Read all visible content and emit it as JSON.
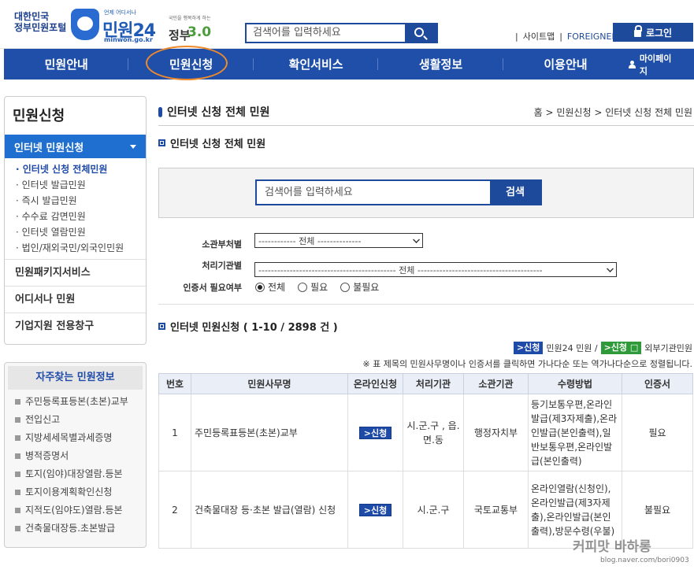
{
  "header": {
    "gov_portal_line1": "대한민국",
    "gov_portal_line2": "정부민원포털",
    "logo_tagline": "언제 어디서나",
    "logo_name": "민원24",
    "logo_url": "minwon.go.kr",
    "gov3_small": "국민을 행복하게 하는",
    "gov3_main": "정부",
    "gov3_num": "3.0",
    "search_placeholder": "검색어를 입력하세요",
    "links": {
      "sitemap": "사이트맵",
      "foreigner": "FOREIGNER"
    },
    "login": "로그인"
  },
  "gnb": {
    "items": [
      "민원안내",
      "민원신청",
      "확인서비스",
      "생활정보",
      "이용안내"
    ],
    "mypage": "마이페이지",
    "highlight_color": "#f08a2b"
  },
  "sidebar": {
    "title": "민원신청",
    "active": "인터넷 민원신청",
    "subitems": [
      "인터넷 신청 전체민원",
      "인터넷 발급민원",
      "즉시 발급민원",
      "수수료 감면민원",
      "인터넷 열람민원",
      "법인/재외국민/외국인민원"
    ],
    "sections": [
      "민원패키지서비스",
      "어디서나 민원",
      "기업지원 전용창구"
    ]
  },
  "frequent": {
    "title": "자주찾는 민원정보",
    "items": [
      "주민등록표등본(초본)교부",
      "전입신고",
      "지방세세목별과세증명",
      "병적증명서",
      "토지(임야)대장열람.등본",
      "토지이용계획확인신청",
      "지적도(임야도)열람.등본",
      "건축물대장등.초본발급"
    ]
  },
  "main": {
    "page_title": "인터넷 신청 전체 민원",
    "breadcrumb": [
      "홈",
      "민원신청",
      "인터넷 신청 전체 민원"
    ],
    "section_title": "인터넷 신청 전체 민원",
    "search_placeholder": "검색어를 입력하세요",
    "search_button": "검색",
    "filters": {
      "dept_label": "소관부처별",
      "dept_value": "------------ 전체 --------------",
      "agency_label": "처리기관별",
      "agency_value": "-------------------------------------------- 전체 ----------------------------------------",
      "cert_label": "인증서 필요여부",
      "cert_options": [
        "전체",
        "필요",
        "불필요"
      ]
    },
    "list_title": "인터넷 민원신청 ( 1-10 / 2898 건 )",
    "legend": {
      "apply_badge": "신청",
      "inner_label": "민원24 민원 /",
      "outer_badge": "신청",
      "outer_label": "외부기관민원"
    },
    "note": "※ 표 제목의 민원사무명이나 인증서를 클릭하면 가나다순 또는 역가나다순으로 정렬됩니다.",
    "table": {
      "headers": [
        "번호",
        "민원사무명",
        "온라인신청",
        "처리기관",
        "소관기관",
        "수령방법",
        "인증서"
      ],
      "rows": [
        {
          "no": "1",
          "name": "주민등록표등본(초본)교부",
          "apply": "신청",
          "proc": "시.군.구 , 읍.면.동",
          "dept": "행정자치부",
          "recv": "등기보통우편,온라인발급(제3자제출),온라인발급(본인출력),일반보통우편,온라인발급(본인출력)",
          "cert": "필요"
        },
        {
          "no": "2",
          "name": "건축물대장 등·초본 발급(열람) 신청",
          "apply": "신청",
          "proc": "시.군.구",
          "dept": "국토교통부",
          "recv": "온라인열람(신청인),온라인발급(제3자제출),온라인발급(본인출력),방문수령(우불)",
          "cert": "불필요"
        }
      ]
    }
  },
  "watermark": {
    "text": "커피맛 바하롱",
    "url": "blog.naver.com/bori0903"
  }
}
